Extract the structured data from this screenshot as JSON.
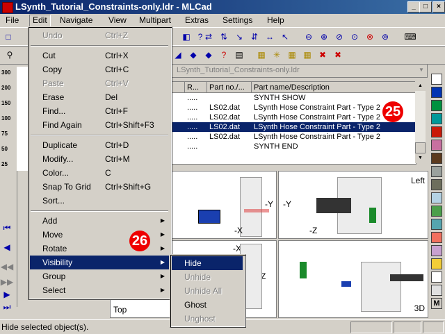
{
  "window": {
    "title": "LSynth_Tutorial_Constraints-only.ldr - MLCad"
  },
  "menubar": [
    "File",
    "Edit",
    "Navigate",
    "View",
    "Multipart",
    "Extras",
    "Settings",
    "Help"
  ],
  "file_combo": "LSynth_Tutorial_Constraints-only.ldr",
  "parts_table": {
    "headers": [
      "R...",
      "Part no./...",
      "Part name/Description"
    ],
    "rows": [
      {
        "r": ".....",
        "part": "",
        "desc": "SYNTH SHOW",
        "selected": false
      },
      {
        "r": ".....",
        "part": "LS02.dat",
        "desc": "LSynth Hose Constraint Part - Type 2",
        "selected": false
      },
      {
        "r": ".....",
        "part": "LS02.dat",
        "desc": "LSynth Hose Constraint Part - Type 2",
        "selected": false
      },
      {
        "r": ".....",
        "part": "LS02.dat",
        "desc": "LSynth Hose Constraint Part - Type 2",
        "selected": true
      },
      {
        "r": ".....",
        "part": "LS02.dat",
        "desc": "LSynth Hose Constraint Part - Type 2",
        "selected": false
      },
      {
        "r": ".....",
        "part": "",
        "desc": "SYNTH END",
        "selected": false
      }
    ]
  },
  "viewports": {
    "left": "Left",
    "top": "Top",
    "persp": "3D"
  },
  "axes": {
    "y": "-Y",
    "x": "-X",
    "z": "-Z"
  },
  "zoom_labels": [
    "300",
    "200",
    "150",
    "100",
    "75",
    "50",
    "25"
  ],
  "callouts": {
    "a": "25",
    "b": "26"
  },
  "edit_menu": [
    {
      "label": "Undo",
      "shortcut": "Ctrl+Z",
      "disabled": true
    },
    {
      "sep": true
    },
    {
      "label": "Cut",
      "shortcut": "Ctrl+X"
    },
    {
      "label": "Copy",
      "shortcut": "Ctrl+C"
    },
    {
      "label": "Paste",
      "shortcut": "Ctrl+V",
      "disabled": true
    },
    {
      "label": "Erase",
      "shortcut": "Del"
    },
    {
      "label": "Find...",
      "shortcut": "Ctrl+F"
    },
    {
      "label": "Find Again",
      "shortcut": "Ctrl+Shift+F3"
    },
    {
      "sep": true
    },
    {
      "label": "Duplicate",
      "shortcut": "Ctrl+D"
    },
    {
      "label": "Modify...",
      "shortcut": "Ctrl+M"
    },
    {
      "label": "Color...",
      "shortcut": "C"
    },
    {
      "label": "Snap To Grid",
      "shortcut": "Ctrl+Shift+G"
    },
    {
      "label": "Sort..."
    },
    {
      "sep": true
    },
    {
      "label": "Add",
      "submenu": true
    },
    {
      "label": "Move",
      "submenu": true
    },
    {
      "label": "Rotate",
      "submenu": true
    },
    {
      "label": "Visibility",
      "submenu": true,
      "highlighted": true
    },
    {
      "label": "Group",
      "submenu": true
    },
    {
      "label": "Select",
      "submenu": true
    }
  ],
  "visibility_menu": [
    {
      "label": "Hide",
      "highlighted": true
    },
    {
      "label": "Unhide",
      "disabled": true
    },
    {
      "label": "Unhide All",
      "disabled": true
    },
    {
      "label": "Ghost"
    },
    {
      "label": "Unghost",
      "disabled": true
    }
  ],
  "palette": [
    "#ffffff",
    "#0033b2",
    "#00923f",
    "#009999",
    "#c91a09",
    "#c870a0",
    "#5c3a1e",
    "#9ba19d",
    "#6d6e5c",
    "#b4d2e3",
    "#4b9f4a",
    "#55a5af",
    "#f2705e",
    "#c8a0d0",
    "#f2cd37",
    "#ffffff",
    "#e0e0e0"
  ],
  "palette_end": "M",
  "status": {
    "text": "Hide selected object(s)."
  }
}
